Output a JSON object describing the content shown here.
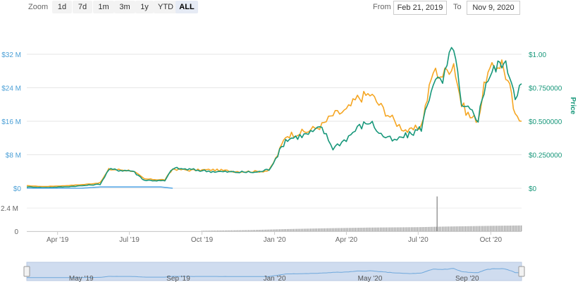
{
  "toolbar": {
    "zoom_label": "Zoom",
    "buttons": [
      "1d",
      "7d",
      "1m",
      "3m",
      "1y",
      "YTD",
      "ALL"
    ],
    "active_button": "ALL",
    "from_label": "From",
    "from_value": "Feb 21, 2019",
    "to_label": "To",
    "to_value": "Nov 9, 2020"
  },
  "colors": {
    "market_cap": "#f5a623",
    "price": "#17977a",
    "early_series": "#5aa9e6",
    "volume": "#999999",
    "navigator_fill": "#cfdcef",
    "navigator_line": "#6fa8dc",
    "left_axis_text": "#4a9fd6",
    "right_axis_text": "#17977a"
  },
  "chart_data": [
    {
      "type": "line",
      "left_axis": {
        "ticks": [
          "$0",
          "$8 M",
          "$16 M",
          "$24 M",
          "$32 M"
        ],
        "tick_values": [
          0,
          8,
          16,
          24,
          32
        ],
        "unit": "M USD",
        "ylim": [
          0,
          32
        ]
      },
      "right_axis": {
        "label": "Price",
        "ticks": [
          "$0",
          "$0.250000",
          "$0.500000",
          "$0.750000",
          "$1.00"
        ],
        "tick_values": [
          0,
          0.25,
          0.5,
          0.75,
          1.0
        ],
        "ylim": [
          0,
          1.0
        ]
      },
      "x_ticks": [
        "Apr '19",
        "Jul '19",
        "Oct '19",
        "Jan '20",
        "Apr '20",
        "Jul '20",
        "Oct '20"
      ],
      "x_tick_dates": [
        "2019-04-01",
        "2019-07-01",
        "2019-10-01",
        "2020-01-01",
        "2020-04-01",
        "2020-07-01",
        "2020-10-01"
      ],
      "x_range": [
        "2019-02-21",
        "2020-11-09"
      ],
      "grid": true,
      "series": [
        {
          "role": "market_cap",
          "axis": "left",
          "x": [
            "2019-02-21",
            "2019-03-15",
            "2019-04-10",
            "2019-05-05",
            "2019-05-25",
            "2019-06-05",
            "2019-06-20",
            "2019-07-05",
            "2019-07-20",
            "2019-08-15",
            "2019-08-25",
            "2019-09-15",
            "2019-10-15",
            "2019-11-15",
            "2019-12-10",
            "2019-12-25",
            "2020-01-05",
            "2020-01-15",
            "2020-01-25",
            "2020-02-10",
            "2020-03-01",
            "2020-03-15",
            "2020-04-01",
            "2020-04-15",
            "2020-05-01",
            "2020-05-15",
            "2020-06-01",
            "2020-06-10",
            "2020-06-20",
            "2020-07-05",
            "2020-07-20",
            "2020-08-01",
            "2020-08-15",
            "2020-08-25",
            "2020-09-05",
            "2020-09-15",
            "2020-09-25",
            "2020-10-05",
            "2020-10-15",
            "2020-10-25",
            "2020-11-01",
            "2020-11-09"
          ],
          "y": [
            0.6,
            0.4,
            0.6,
            0.9,
            1.3,
            4.5,
            4.4,
            4.2,
            2.2,
            2.0,
            4.6,
            4.3,
            4.4,
            4.0,
            4.0,
            4.2,
            8.0,
            12.5,
            13.0,
            13.5,
            15.0,
            17.5,
            18.5,
            21.5,
            22.5,
            19.5,
            16.0,
            14.5,
            13.5,
            15.0,
            28.0,
            27.0,
            30.0,
            20.0,
            17.0,
            16.5,
            26.5,
            29.0,
            30.0,
            24.0,
            17.0,
            16.0
          ]
        },
        {
          "role": "price",
          "axis": "right",
          "x": [
            "2019-02-21",
            "2019-03-15",
            "2019-04-10",
            "2019-05-05",
            "2019-05-25",
            "2019-06-05",
            "2019-06-20",
            "2019-07-05",
            "2019-07-20",
            "2019-08-15",
            "2019-08-25",
            "2019-09-15",
            "2019-10-15",
            "2019-11-15",
            "2019-12-10",
            "2019-12-25",
            "2020-01-05",
            "2020-01-15",
            "2020-01-25",
            "2020-02-10",
            "2020-03-01",
            "2020-03-15",
            "2020-04-01",
            "2020-04-15",
            "2020-05-01",
            "2020-05-15",
            "2020-06-01",
            "2020-06-10",
            "2020-06-20",
            "2020-07-05",
            "2020-07-20",
            "2020-08-01",
            "2020-08-15",
            "2020-08-25",
            "2020-09-05",
            "2020-09-15",
            "2020-09-25",
            "2020-10-05",
            "2020-10-15",
            "2020-10-25",
            "2020-11-01",
            "2020-11-09"
          ],
          "y": [
            0.01,
            0.005,
            0.01,
            0.02,
            0.03,
            0.14,
            0.135,
            0.13,
            0.06,
            0.055,
            0.15,
            0.14,
            0.125,
            0.12,
            0.12,
            0.14,
            0.25,
            0.36,
            0.38,
            0.4,
            0.45,
            0.3,
            0.37,
            0.45,
            0.5,
            0.4,
            0.35,
            0.38,
            0.4,
            0.45,
            0.8,
            0.79,
            1.08,
            0.6,
            0.58,
            0.52,
            0.8,
            0.88,
            0.95,
            0.86,
            0.7,
            0.78
          ]
        },
        {
          "role": "early",
          "axis": "left",
          "x": [
            "2019-02-21",
            "2019-05-01",
            "2019-05-25",
            "2019-08-10",
            "2019-08-25"
          ],
          "y": [
            0.0,
            0.0,
            0.3,
            0.3,
            0.0
          ]
        }
      ]
    },
    {
      "type": "bar",
      "axis_ticks": [
        "0",
        "2.4 M"
      ],
      "tick_values": [
        0,
        2.4
      ],
      "ylim": [
        0,
        3.5
      ],
      "unit": "M USD",
      "x_range": [
        "2019-02-21",
        "2020-11-09"
      ],
      "volume_series": {
        "x": [
          "2019-10-01",
          "2019-12-01",
          "2020-01-15",
          "2020-03-01",
          "2020-05-01",
          "2020-07-01",
          "2020-07-25",
          "2020-08-01",
          "2020-09-01",
          "2020-10-01",
          "2020-11-09"
        ],
        "y": [
          0.05,
          0.12,
          0.22,
          0.3,
          0.38,
          0.42,
          3.6,
          0.48,
          0.52,
          0.56,
          0.6
        ]
      }
    },
    {
      "type": "area",
      "x_ticks": [
        "May '19",
        "Sep '19",
        "Jan '20",
        "May '20",
        "Sep '20"
      ],
      "x_tick_dates": [
        "2019-05-01",
        "2019-09-01",
        "2020-01-01",
        "2020-05-01",
        "2020-09-01"
      ],
      "x_range": [
        "2019-02-21",
        "2020-11-09"
      ]
    }
  ]
}
